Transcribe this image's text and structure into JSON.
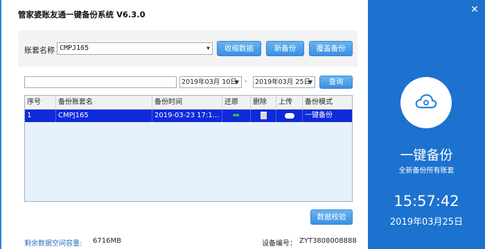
{
  "app": {
    "title": "管家婆账友通一键备份系统 V6.3.0"
  },
  "top": {
    "account_label": "账套名称",
    "account_value": "CMPJ165",
    "buttons": {
      "collect": "收缩数据",
      "new_backup": "新备份",
      "overwrite": "覆盖备份"
    }
  },
  "filter": {
    "search_value": "",
    "start_date": "2019年03月 10日",
    "end_date": "2019年03月 25日",
    "separator": "-",
    "query_label": "查询"
  },
  "table": {
    "columns": [
      "序号",
      "备份账套名",
      "备份时间",
      "还原",
      "删除",
      "上传",
      "备份模式"
    ],
    "rows": [
      {
        "index": "1",
        "name": "CMPJ165",
        "time": "2019-03-23 17:1...",
        "mode": "一键备份"
      }
    ]
  },
  "verify_label": "数据校验",
  "footer": {
    "space_label": "剩余数据空间容量:",
    "space_value": "6716MB",
    "device_label": "设备编号：",
    "device_value": "ZYT3808008888"
  },
  "side": {
    "product_name": "一键备份",
    "subtitle": "全新备份所有账套",
    "time": "15:57:42",
    "date": "2019年03月25日",
    "icon": "cloud-icon",
    "accent": "#1d72cf"
  }
}
